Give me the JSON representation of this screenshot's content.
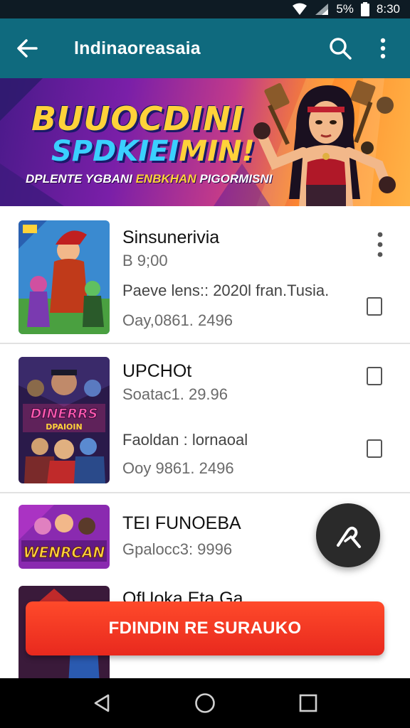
{
  "status_bar": {
    "battery": "5%",
    "time": "8:30"
  },
  "app_bar": {
    "title": "lndinaoreasaia"
  },
  "banner": {
    "line1": "BUUOCDINI",
    "line2_a": "SPDKIEI",
    "line2_b": "MIN!",
    "sub_a": "DPLENTE YGBANI ",
    "sub_b": "ENBKHAN",
    "sub_c": " PIGORMISNI"
  },
  "list": {
    "items": [
      {
        "title": "Sinsunerivia",
        "subtitle": "B 9;00",
        "line3": "Paeve lens:: 2020l fran.Tusia.",
        "line4": "Oay,0861. 2496"
      },
      {
        "title": "UPCHOt",
        "subtitle": "Soatac1. 29.96",
        "line3": "Faoldan : lornaoal",
        "line4": "Ooy 9861. 2496"
      },
      {
        "title": "TEI FUNOEBA",
        "subtitle": "Gpalocc3: 9996",
        "thumb_text": "WENRCAN"
      },
      {
        "title": "OfUoka Eta Ga"
      }
    ],
    "thumb2_text_a": "DINERRS",
    "thumb2_text_b": "DPAIOIN"
  },
  "cta": {
    "label": "FDINDIN RE SURAUKO"
  },
  "colors": {
    "app_bar": "#0f6a7e",
    "cta": "#e8291e",
    "fab": "#2a2a2a"
  },
  "icons": [
    "wifi-icon",
    "signal-icon",
    "battery-icon",
    "back-arrow-icon",
    "search-icon",
    "more-vert-icon",
    "checkbox-icon",
    "fab-icon",
    "nav-back-icon",
    "nav-home-icon",
    "nav-recents-icon"
  ]
}
